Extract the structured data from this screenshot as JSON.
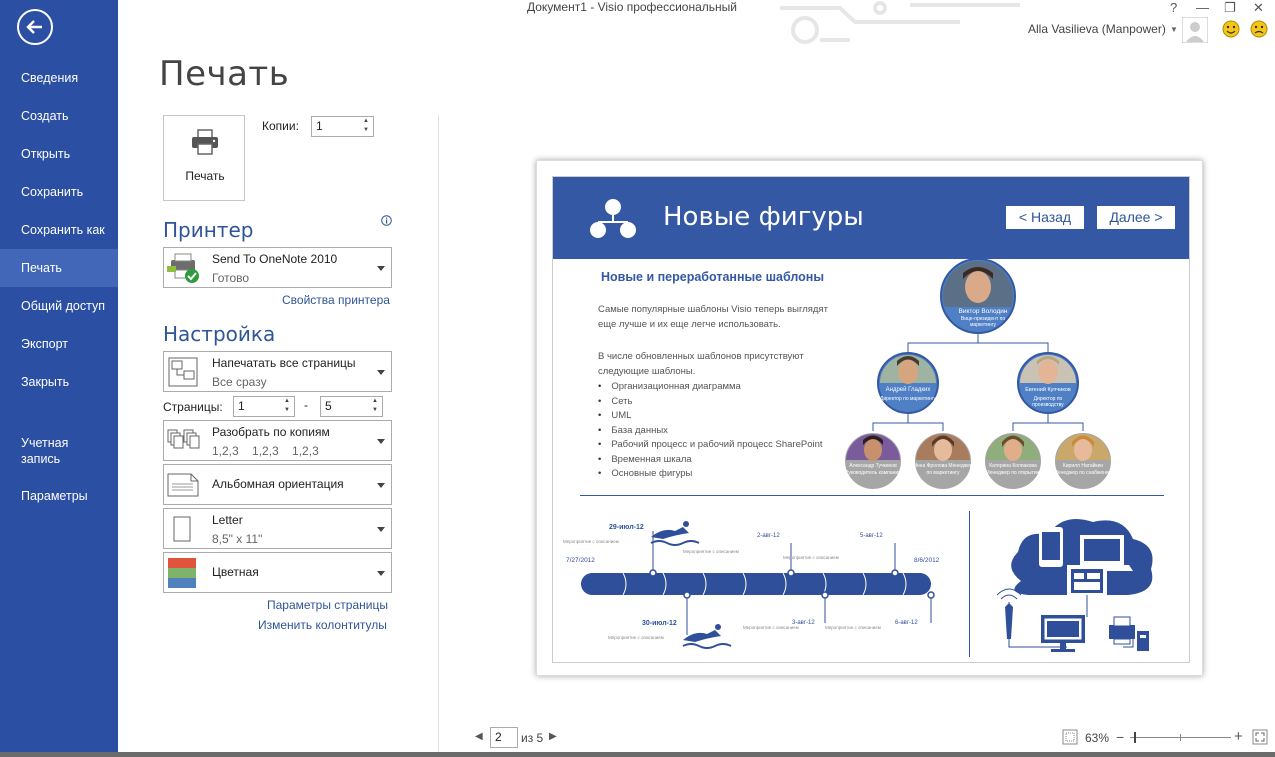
{
  "window": {
    "title": "Документ1 -  Visio профессиональный",
    "user": "Alla Vasilieva (Manpower)",
    "controls": {
      "help": "?",
      "minimize": "—",
      "restore": "❐",
      "close": "✕"
    }
  },
  "sidebar": {
    "items": [
      {
        "label": "Сведения",
        "active": false
      },
      {
        "label": "Создать",
        "active": false
      },
      {
        "label": "Открыть",
        "active": false
      },
      {
        "label": "Сохранить",
        "active": false
      },
      {
        "label": "Сохранить как",
        "active": false
      },
      {
        "label": "Печать",
        "active": true
      },
      {
        "label": "Общий доступ",
        "active": false
      },
      {
        "label": "Экспорт",
        "active": false
      },
      {
        "label": "Закрыть",
        "active": false
      },
      {
        "label": "Учетная\nзапись",
        "active": false
      },
      {
        "label": "Параметры",
        "active": false
      }
    ]
  },
  "print": {
    "title": "Печать",
    "button_label": "Печать",
    "copies_label": "Копии:",
    "copies_value": "1",
    "printer_header": "Принтер",
    "printer_name": "Send To OneNote 2010",
    "printer_status": "Готово",
    "printer_props_link": "Свойства принтера",
    "settings_header": "Настройка",
    "pages_mode": "Напечатать все страницы",
    "pages_mode_sub": "Все сразу",
    "pages_label": "Страницы:",
    "pages_from": "1",
    "pages_dash": "-",
    "pages_to": "5",
    "collate": "Разобрать по копиям",
    "collate_sub": "1,2,3    1,2,3    1,2,3",
    "orientation": "Альбомная ориентация",
    "paper": "Letter",
    "paper_sub": "8,5\" x 11\"",
    "color": "Цветная",
    "page_setup_link": "Параметры страницы",
    "header_footer_link": "Изменить колонтитулы"
  },
  "preview": {
    "title": "Новые фигуры",
    "back": "< Назад",
    "next": "Далее >",
    "subtitle": "Новые и переработанные шаблоны",
    "para1": "Самые популярные шаблоны Visio теперь выглядят еще лучше и их еще легче использовать.",
    "para2": "В числе обновленных шаблонов присутствуют следующие шаблоны.",
    "bullets": [
      "Организационная диаграмма",
      "Сеть",
      "UML",
      "База данных",
      "Рабочий процесс и рабочий процесс SharePoint",
      "Временная шкала",
      "Основные фигуры"
    ],
    "org": {
      "top_name": "Виктор Володин",
      "top_role": "Вице-президент по маркетингу",
      "mid_left_name": "Андрей Гладких",
      "mid_left_role": "Директор по маркетингу",
      "mid_right_name": "Евгений Купчиков",
      "mid_right_role": "Директор по производству",
      "b1_name": "Александр Тучкинов",
      "b1_role": "Руководитель компании",
      "b2_name": "Инна Фролова",
      "b2_role": "Менеджер по маркетингу",
      "b3_name": "Катерина Колпакова",
      "b3_role": "Менеджер по открытию",
      "b4_name": "Кирилл Натайкин",
      "b4_role": "Менеджер по снабжению"
    },
    "timeline": {
      "start": "7/27/2012",
      "end": "8/6/2012",
      "top1": "29-июл-12",
      "top2": "2-авг-12",
      "top3": "5-авг-12",
      "bot1": "30-июл-12",
      "bot2": "3-авг-12",
      "bot3": "6-авг-12"
    }
  },
  "footer": {
    "page_current": "2",
    "page_of": "из 5",
    "zoom": "63%"
  },
  "colors": {
    "sidebar": "#2a4fa3",
    "sidebar_active": "#4367b8",
    "accent": "#2f5597",
    "preview_header": "#3458a4"
  }
}
